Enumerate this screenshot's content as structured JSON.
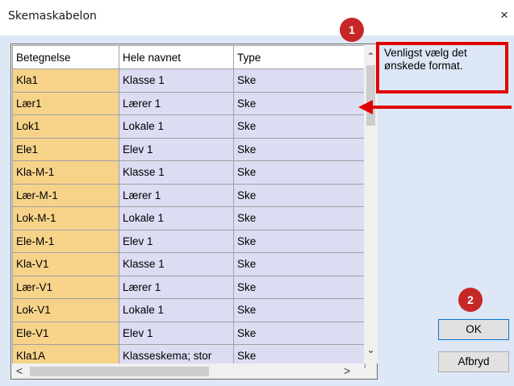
{
  "window": {
    "title": "Skemaskabelon",
    "close_symbol": "×"
  },
  "grid": {
    "headers": [
      "Betegnelse",
      "Hele navnet",
      "Type"
    ],
    "rows": [
      [
        "Kla1",
        "Klasse 1",
        "Ske"
      ],
      [
        "Lær1",
        "Lærer 1",
        "Ske"
      ],
      [
        "Lok1",
        "Lokale 1",
        "Ske"
      ],
      [
        "Ele1",
        "Elev 1",
        "Ske"
      ],
      [
        "Kla-M-1",
        "Klasse 1",
        "Ske"
      ],
      [
        "Lær-M-1",
        "Lærer 1",
        "Ske"
      ],
      [
        "Lok-M-1",
        "Lokale 1",
        "Ske"
      ],
      [
        "Ele-M-1",
        "Elev 1",
        "Ske"
      ],
      [
        "Kla-V1",
        "Klasse 1",
        "Ske"
      ],
      [
        "Lær-V1",
        "Lærer 1",
        "Ske"
      ],
      [
        "Lok-V1",
        "Lokale 1",
        "Ske"
      ],
      [
        "Ele-V1",
        "Elev 1",
        "Ske"
      ],
      [
        "Kla1A",
        "Klasseskema; stor",
        "Ske"
      ]
    ],
    "scroll_up": "⌃",
    "scroll_down": "⌄",
    "scroll_left": "<",
    "scroll_right": ">"
  },
  "info": {
    "line1": "Venligst vælg det",
    "line2": "ønskede format."
  },
  "badges": {
    "one": "1",
    "two": "2"
  },
  "buttons": {
    "ok": "OK",
    "cancel": "Afbryd"
  },
  "colors": {
    "dialog_bg": "#dde7f5",
    "first_column": "#f7d38a",
    "other_columns": "#dcdcf3",
    "annotation_red": "#e00000",
    "badge_red": "#c62828"
  }
}
